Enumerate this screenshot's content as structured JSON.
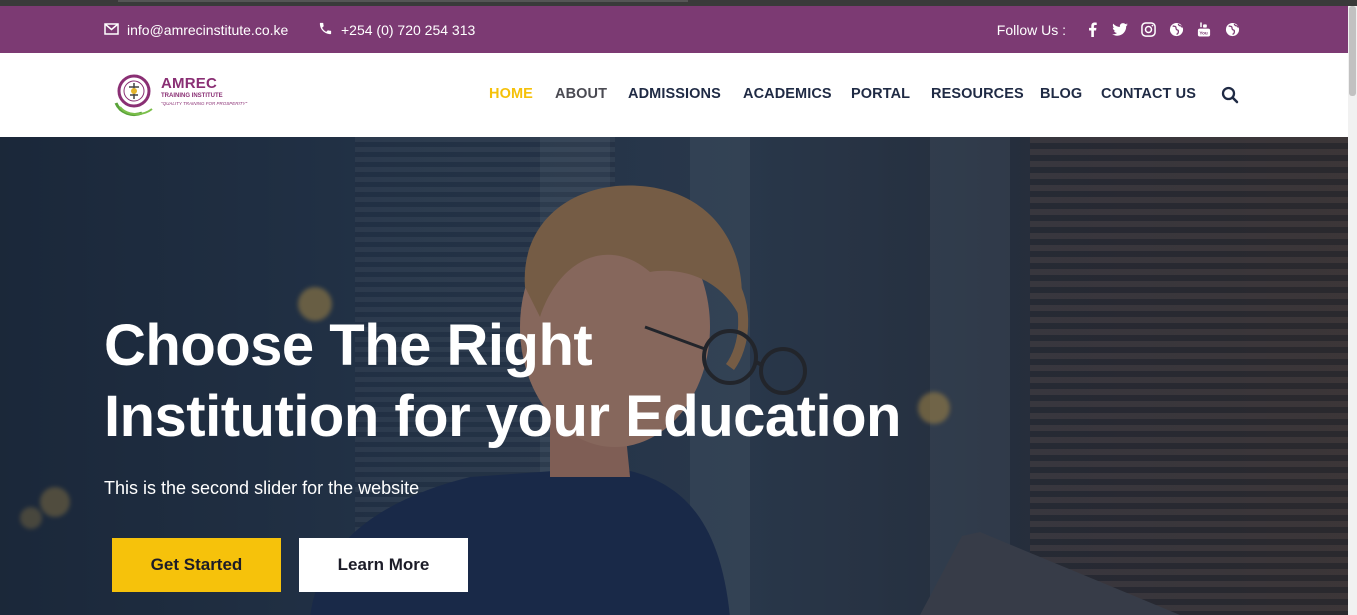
{
  "topbar": {
    "email": "info@amrecinstitute.co.ke",
    "phone": "+254 (0) 720 254 313",
    "follow_label": "Follow Us :",
    "social_icons": [
      "facebook-icon",
      "twitter-icon",
      "instagram-icon",
      "globe-icon",
      "youtube-icon",
      "globe-icon"
    ],
    "background": "#7c3a73"
  },
  "logo": {
    "name": "AMREC",
    "subtitle": "TRAINING INSTITUTE",
    "tagline": "\"QUALITY TRAINING FOR PROSPERITY\""
  },
  "nav": {
    "items": [
      {
        "label": "HOME",
        "active": true
      },
      {
        "label": "ABOUT"
      },
      {
        "label": "ADMISSIONS"
      },
      {
        "label": "ACADEMICS"
      },
      {
        "label": "PORTAL"
      },
      {
        "label": "RESOURCES"
      },
      {
        "label": "BLOG"
      },
      {
        "label": "CONTACT US"
      }
    ],
    "active_color": "#f5c10a",
    "search_icon": "search-icon"
  },
  "hero": {
    "title_line1": "Choose The Right",
    "title_line2": "Institution for your Education",
    "subtitle": "This is the second slider for the website",
    "primary_button": "Get Started",
    "secondary_button": "Learn More",
    "accent": "#f6c20b"
  }
}
